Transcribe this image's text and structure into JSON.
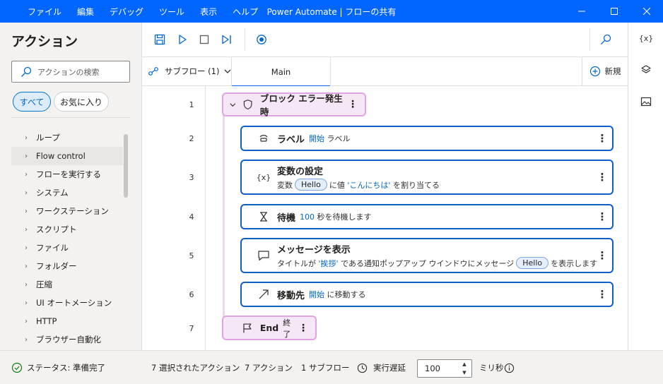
{
  "window": {
    "title": "Power Automate | フローの共有",
    "menu": [
      "ファイル",
      "編集",
      "デバッグ",
      "ツール",
      "表示",
      "ヘルプ"
    ]
  },
  "left_panel": {
    "title": "アクション",
    "search_placeholder": "アクションの検索",
    "filters": [
      "すべて",
      "お気に入り"
    ],
    "categories": [
      "ループ",
      "Flow control",
      "フローを実行する",
      "システム",
      "ワークステーション",
      "スクリプト",
      "ファイル",
      "フォルダー",
      "圧縮",
      "UI オートメーション",
      "HTTP",
      "ブラウザー自動化"
    ],
    "selected_category": "Flow control"
  },
  "tabs": {
    "subflow_label": "サブフロー (1)",
    "main_label": "Main",
    "new_label": "新規"
  },
  "flow": {
    "line_numbers": [
      "1",
      "2",
      "3",
      "4",
      "5",
      "6",
      "7"
    ],
    "block_start": {
      "title": "ブロック エラー発生時"
    },
    "actions": [
      {
        "name": "ラベル",
        "value": "開始",
        "suffix": "ラベル"
      },
      {
        "name": "変数の設定",
        "prefix": "変数",
        "chip": "Hello",
        "mid": "に値",
        "value": "'こんにちは'",
        "suffix": "を割り当てる"
      },
      {
        "name": "待機",
        "value": "100",
        "suffix": "秒を待機します"
      },
      {
        "name": "メッセージを表示",
        "prefix": "タイトルが",
        "value": "'挨拶'",
        "mid": "である通知ポップアップ ウインドウにメッセージ",
        "chip": "Hello",
        "suffix": "を表示します"
      },
      {
        "name": "移動先",
        "value": "開始",
        "suffix": "に移動する"
      }
    ],
    "block_end": {
      "title": "End",
      "subtitle": "終了"
    }
  },
  "right_rail": {
    "variables_label": "{x}"
  },
  "status_bar": {
    "status": "ステータス: 準備完了",
    "selected": "7 選択されたアクション",
    "actions": "7 アクション",
    "subflows": "1 サブフロー",
    "delay_label": "実行遅延",
    "delay_value": "100",
    "delay_unit": "ミリ秒"
  }
}
